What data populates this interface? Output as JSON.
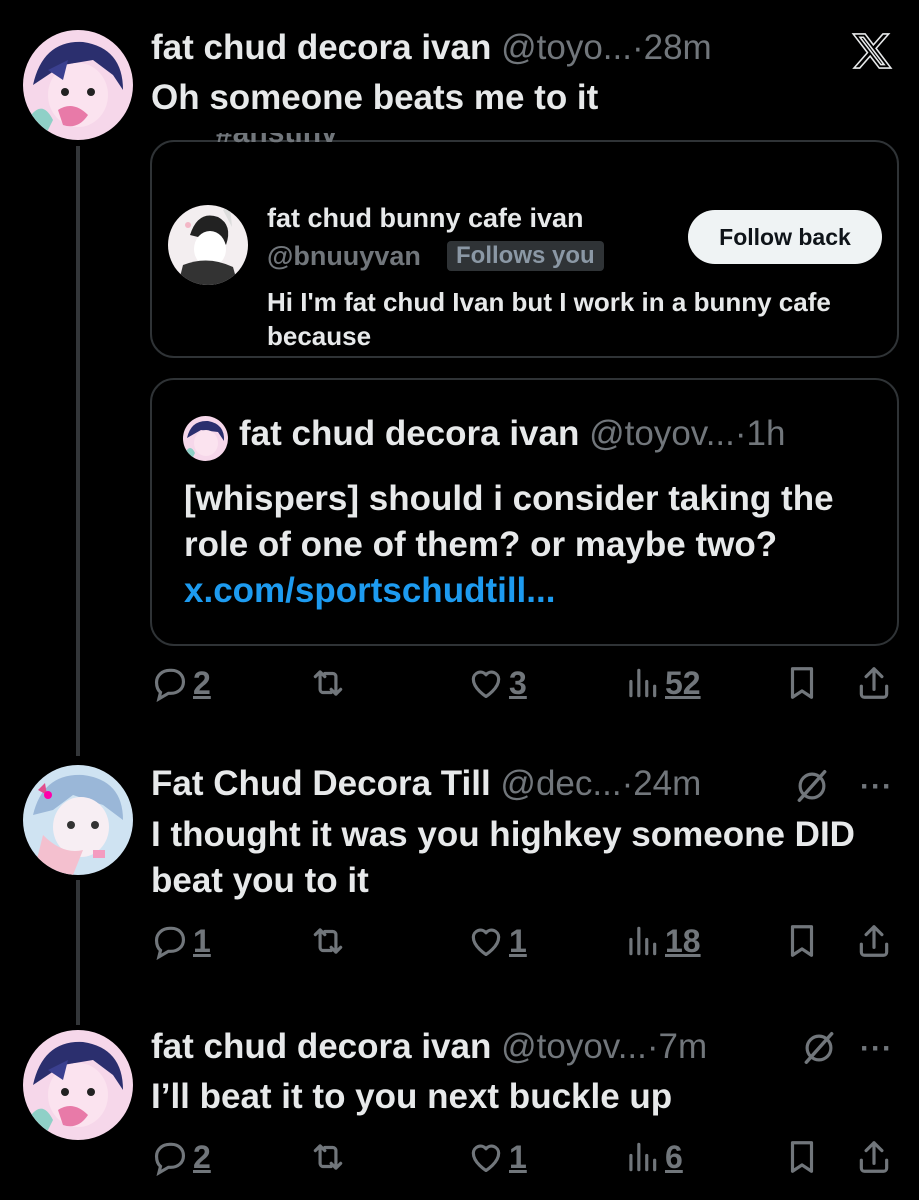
{
  "x_logo": "x-logo-icon",
  "tweets": [
    {
      "name": "fat chud decora ivan",
      "handle": "@toyo...",
      "time": "28m",
      "text": "Oh someone beats me to it",
      "replies": "2",
      "likes": "3",
      "views": "52"
    },
    {
      "name": "Fat Chud Decora Till",
      "handle": "@dec...",
      "time": "24m",
      "text": "I thought it was you highkey someone DID beat you to it",
      "replies": "1",
      "likes": "1",
      "views": "18"
    },
    {
      "name": "fat chud decora ivan",
      "handle": "@toyov...",
      "time": "7m",
      "text": "I’ll beat it to you next buckle up",
      "replies": "2",
      "likes": "1",
      "views": "6"
    }
  ],
  "profile_card": {
    "clipped_text": "#anstinv",
    "name": "fat chud bunny cafe ivan",
    "handle": "@bnuuyvan",
    "follows_badge": "Follows you",
    "follow_button": "Follow back",
    "bio": "Hi I'm fat chud Ivan but I work in a bunny cafe because"
  },
  "quote": {
    "name": "fat chud decora ivan",
    "handle": "@toyov...",
    "time": "1h",
    "text": "[whispers] should i consider taking the role of one of them? or maybe two?",
    "link": "x.com/sportschudtill..."
  },
  "sep": "·",
  "colors": {
    "background": "#000000",
    "text": "#e7e9ea",
    "muted": "#71767b",
    "link": "#1d9bf0",
    "border": "#2f3336"
  }
}
